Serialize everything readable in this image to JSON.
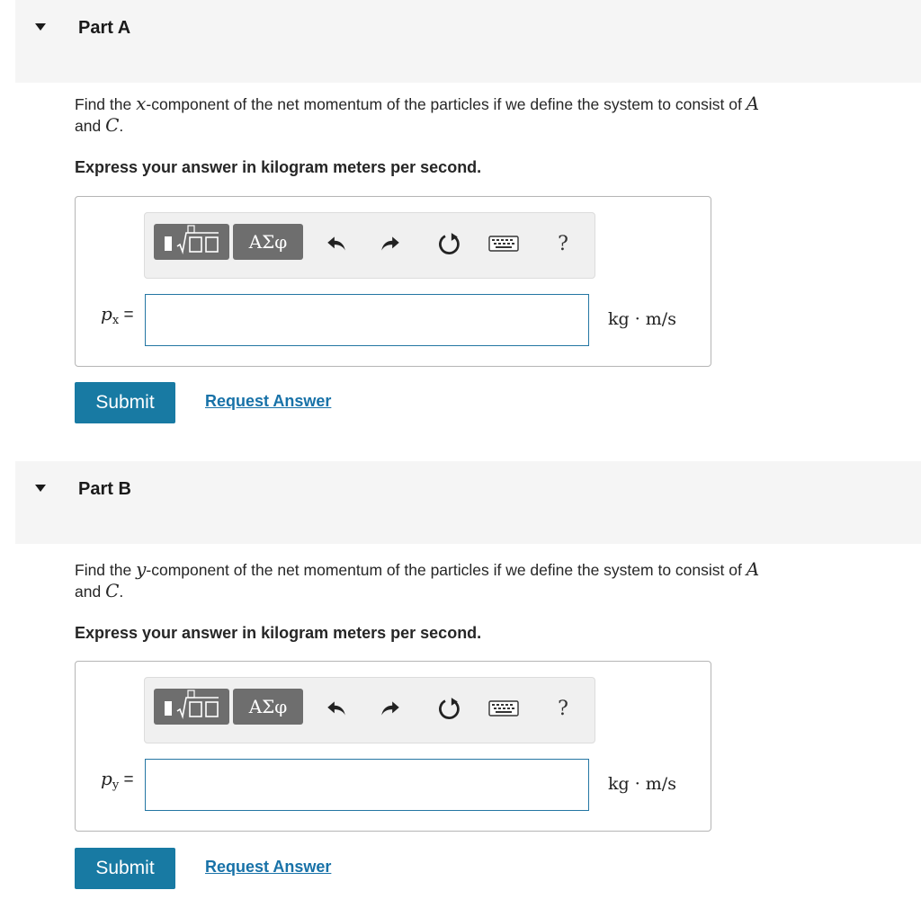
{
  "parts": [
    {
      "title": "Part A",
      "question": {
        "before": "Find the ",
        "component_var": "x",
        "middle": "-component of the net momentum of the particles if we define the system to consist of ",
        "var_a": "A",
        "joiner": " and ",
        "var_c": "C",
        "end": "."
      },
      "instruction": "Express your answer in kilogram meters per second.",
      "toolbar": {
        "symbols_label": "ΑΣφ",
        "help_label": "?"
      },
      "answer": {
        "var_symbol": "p",
        "var_subscript": "x",
        "equals": "=",
        "value": "",
        "units": "kg · m/s"
      },
      "submit_label": "Submit",
      "request_answer_label": "Request Answer"
    },
    {
      "title": "Part B",
      "question": {
        "before": "Find the ",
        "component_var": "y",
        "middle": "-component of the net momentum of the particles if we define the system to consist of ",
        "var_a": "A",
        "joiner": " and ",
        "var_c": "C",
        "end": "."
      },
      "instruction": "Express your answer in kilogram meters per second.",
      "toolbar": {
        "symbols_label": "ΑΣφ",
        "help_label": "?"
      },
      "answer": {
        "var_symbol": "p",
        "var_subscript": "y",
        "equals": "=",
        "value": "",
        "units": "kg · m/s"
      },
      "submit_label": "Submit",
      "request_answer_label": "Request Answer"
    }
  ],
  "colors": {
    "accent": "#187aa3",
    "link": "#1872a8",
    "input_border": "#2476a3",
    "header_bg": "#f5f5f5",
    "toolbar_button": "#6e6e6e"
  }
}
